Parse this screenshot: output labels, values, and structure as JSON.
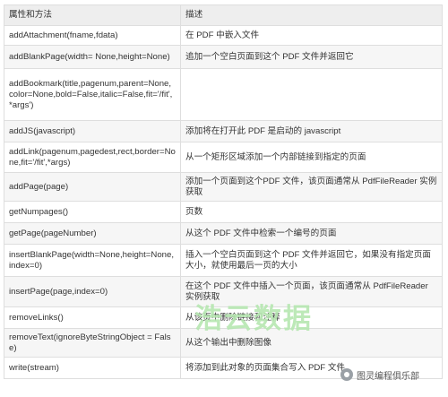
{
  "table": {
    "headers": [
      "属性和方法",
      "描述"
    ],
    "rows": [
      {
        "method": "addAttachment(fname,fdata)",
        "desc": "在 PDF 中嵌入文件"
      },
      {
        "method": "addBlankPage(width= None,height=None)",
        "desc": "追加一个空白页面到这个 PDF 文件并返回它"
      },
      {
        "method": "addBookmark(title,pagenum,parent=None, color=None,bold=False,italic=False,fit='/fit',*args')",
        "desc": ""
      },
      {
        "method": "addJS(javascript)",
        "desc": "添加将在打开此 PDF 是启动的 javascript"
      },
      {
        "method": "addLink(pagenum,pagedest,rect,border=None,fit='/fit',*args)",
        "desc": "从一个矩形区域添加一个内部链接到指定的页面"
      },
      {
        "method": "addPage(page)",
        "desc": "添加一个页面到这个PDF 文件，该页面通常从 PdfFileReader 实例获取"
      },
      {
        "method": "getNumpages()",
        "desc": "页数"
      },
      {
        "method": "getPage(pageNumber)",
        "desc": "从这个 PDF 文件中检索一个编号的页面"
      },
      {
        "method": "insertBlankPage(width=None,height=None,index=0)",
        "desc": "插入一个空白页面到这个 PDF 文件并返回它，如果没有指定页面大小，就使用最后一页的大小"
      },
      {
        "method": "insertPage(page,index=0)",
        "desc": "在这个 PDF 文件中插入一个页面，该页面通常从 PdfFileReader 实例获取"
      },
      {
        "method": "removeLinks()",
        "desc": "从该页中删除链接和注释"
      },
      {
        "method": "removeText(ignoreByteStringObject = False)",
        "desc": "从这个输出中删除图像"
      },
      {
        "method": "write(stream)",
        "desc": "将添加到此对象的页面集合写入 PDF 文件"
      }
    ]
  },
  "watermark": {
    "text": "浩云数据",
    "badge": "图灵编程俱乐部"
  }
}
